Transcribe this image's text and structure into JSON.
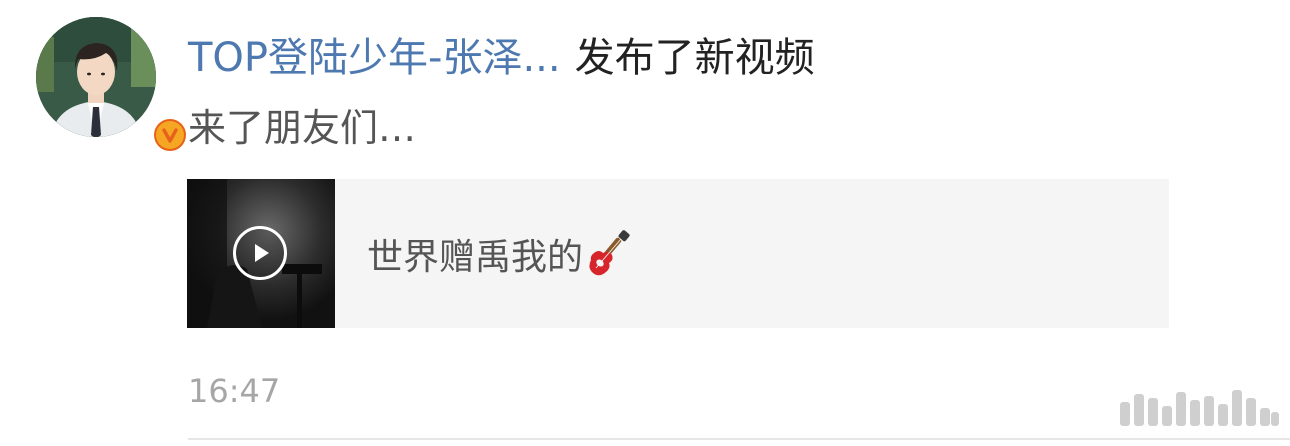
{
  "post": {
    "username": "TOP登陆少年-张泽...",
    "action": "发布了新视频",
    "text": "来了朋友们…",
    "timestamp": "16:47"
  },
  "video": {
    "title": "世界赠禹我的",
    "title_emoji_icon": "guitar-icon",
    "play_icon": "play-icon"
  },
  "avatar": {
    "badge_letter": "v",
    "badge_icon": "verified-badge-icon"
  },
  "colors": {
    "username": "#4d79b0",
    "action_text": "#222222",
    "body_text": "#555555",
    "timestamp": "#a6a6a6",
    "card_bg": "#f5f5f5",
    "badge": "#f5a623"
  }
}
